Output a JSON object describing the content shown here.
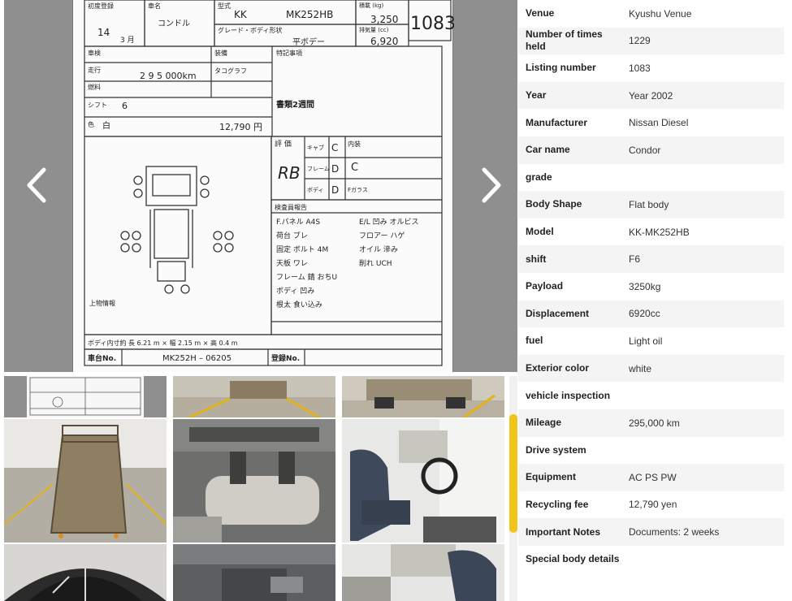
{
  "gallery": {
    "main_photo_alt": "Auction inspection sheet",
    "sheet": {
      "first_reg_label": "初度登録",
      "first_reg_year": "14",
      "first_reg_month": "3 月",
      "car_name_label": "車名",
      "car_name": "コンドル",
      "model_label": "型式",
      "model_prefix": "KK",
      "model_code": "MK252HB",
      "grade_label": "グレード・ボディ形状",
      "body": "平ボデー",
      "payload_label": "積載 (kg)",
      "payload": "3,250",
      "displacement_label": "排気量 (cc)",
      "displacement": "6,920",
      "lot_number": "1083",
      "inspection_label": "車検",
      "mileage_label": "走行",
      "mileage": "2 9 5 000km",
      "fuel_label": "燃料",
      "shift_label": "シフト",
      "shift": "6",
      "color_label": "色",
      "color": "白",
      "recycle_amount": "12,790 円",
      "equipment_label": "装備",
      "tachograph_label": "タコグラフ",
      "special_label": "特記事項",
      "documents_note": "書類2週間",
      "grade_score_label": "評 価",
      "grade_score": "RB",
      "interior_label": "内装",
      "interior_score": "C",
      "cab_label": "キャブ",
      "cab_score": "C",
      "frame_label": "フレーム",
      "frame_score": "D",
      "body_label": "ボディ",
      "body_score": "D",
      "glass_label": "Fガラス",
      "report_label": "検査員報告",
      "notes": [
        "F.パネル A4S",
        "荷台 ブレ",
        "固定 ボルト 4M",
        "天板 ワレ",
        "フレーム 錆 おちU",
        "ボディ 凹み",
        "根太 食い込み"
      ],
      "notes_right": [
        "E/L 凹み オルビス",
        "フロアー ハゲ",
        "オイル 滲み",
        "削れ UCH"
      ],
      "cargo_label": "上物情報",
      "dimensions": "ボディ内寸約 長 6.21 m × 幅 2.15 m × 高 0.4 m",
      "chassis_label": "車台No.",
      "chassis_no": "MK252H – 06205",
      "registration_label": "登録No."
    },
    "thumbnail_count": 9
  },
  "specs": [
    {
      "label": "Venue",
      "value": "Kyushu Venue"
    },
    {
      "label": "Number of times held",
      "value": "1229"
    },
    {
      "label": "Listing number",
      "value": "1083"
    },
    {
      "label": "Year",
      "value": "Year 2002"
    },
    {
      "label": "Manufacturer",
      "value": "Nissan Diesel"
    },
    {
      "label": "Car name",
      "value": "Condor"
    },
    {
      "label": "grade",
      "value": ""
    },
    {
      "label": "Body Shape",
      "value": "Flat body"
    },
    {
      "label": "Model",
      "value": "KK-MK252HB"
    },
    {
      "label": "shift",
      "value": "F6"
    },
    {
      "label": "Payload",
      "value": "3250kg"
    },
    {
      "label": "Displacement",
      "value": "6920cc"
    },
    {
      "label": "fuel",
      "value": "Light oil"
    },
    {
      "label": "Exterior color",
      "value": "white"
    },
    {
      "label": "vehicle inspection",
      "value": ""
    },
    {
      "label": "Mileage",
      "value": "295,000 km"
    },
    {
      "label": "Drive system",
      "value": ""
    },
    {
      "label": "Equipment",
      "value": "AC PS PW"
    },
    {
      "label": "Recycling fee",
      "value": "12,790 yen"
    },
    {
      "label": "Important Notes",
      "value": "Documents: 2 weeks"
    },
    {
      "label": "Special body details",
      "value": ""
    }
  ],
  "colors": {
    "accent": "#f0c419",
    "row_alt": "#f4f4f4",
    "photo_bg": "#8f8f8f"
  }
}
